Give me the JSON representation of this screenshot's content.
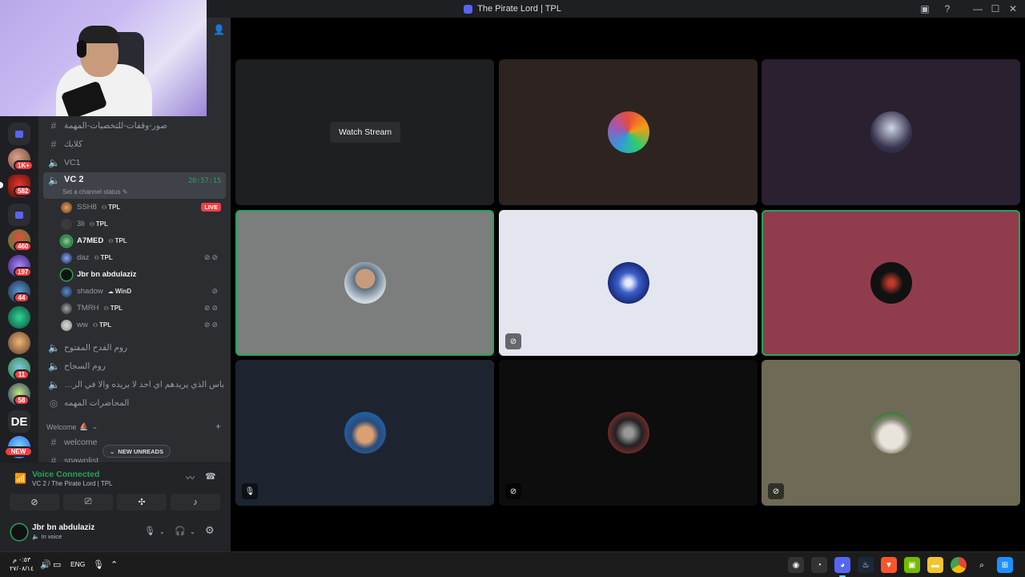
{
  "window": {
    "title": "The Pirate Lord | TPL"
  },
  "rail": {
    "badges": [
      "1K+",
      "582",
      "460",
      "197",
      "44",
      "11",
      "58",
      "NEW"
    ],
    "de_label": "DE"
  },
  "channels": [
    {
      "type": "text",
      "label": "صور-وقفات-للتخصيات-المهمة"
    },
    {
      "type": "text",
      "label": "كلايك"
    },
    {
      "type": "voice",
      "label": "VC1"
    },
    {
      "type": "voice",
      "label": "VC 2",
      "active": true,
      "timer": "20:57:15",
      "status": "Set a channel status"
    }
  ],
  "voice_members": [
    {
      "name": "SSH8",
      "tag": "TPL",
      "live": "LIVE"
    },
    {
      "name": "3li",
      "tag": "TPL"
    },
    {
      "name": "A7MED",
      "tag": "TPL",
      "speaking": true
    },
    {
      "name": "daz",
      "tag": "TPL",
      "state_icons": "🎙̸🎧̸"
    },
    {
      "name": "Jbr bn abdulaziz",
      "tag": "",
      "speaking": true
    },
    {
      "name": "shadow",
      "tag": "WinD",
      "state_icons": "🎙̸"
    },
    {
      "name": "TMRH",
      "tag": "TPL",
      "state_icons": "🎙̸🎧̸"
    },
    {
      "name": "ww",
      "tag": "TPL",
      "state_icons": "🎙̸🎧̸"
    }
  ],
  "channels_after": [
    {
      "type": "voice",
      "label": "روم الفدح المفتوح"
    },
    {
      "type": "voice",
      "label": "روم السجاح"
    },
    {
      "type": "voice",
      "label": "باس الذي يريدهم اي احد لا يريده والا في الروم دايم اوت"
    },
    {
      "type": "stage",
      "label": "المحاضرات المهمه"
    }
  ],
  "category": {
    "label": "Welcome",
    "emoji": "⛵"
  },
  "channels_bottom": [
    {
      "type": "text",
      "label": "welcome"
    },
    {
      "type": "text",
      "label": "spawnlist"
    }
  ],
  "new_unreads": "NEW UNREADS",
  "voice_panel": {
    "title": "Voice Connected",
    "subtitle": "VC 2 / The Pirate Lord | TPL"
  },
  "user_panel": {
    "name": "Jbr bn abdulaziz",
    "status": "In voice"
  },
  "stage": {
    "watch_stream_label": "Watch Stream",
    "tiles": [
      {
        "bg": "#1e1f22",
        "kind": "stream"
      },
      {
        "bg": "#2d2421",
        "avatar": "rainbow",
        "speaking": false
      },
      {
        "bg": "#2a2030",
        "avatar": "night",
        "speaking": false
      },
      {
        "bg": "#7b7e7d",
        "avatar": "person",
        "speaking": true
      },
      {
        "bg": "#e3e5ef",
        "avatar": "blue-swirl",
        "corner": "deafened",
        "speaking": false
      },
      {
        "bg": "#913c4d",
        "avatar": "dark-red",
        "speaking": true
      },
      {
        "bg": "#1d2430",
        "avatar": "pirate",
        "corner": "muted",
        "speaking": false
      },
      {
        "bg": "#0d0d0d",
        "avatar": "robot",
        "corner": "deafened",
        "speaking": false
      },
      {
        "bg": "#6e6a56",
        "avatar": "cat",
        "corner": "deafened",
        "speaking": false
      }
    ]
  },
  "taskbar": {
    "time": "٠:٥٣ م",
    "date": "٢٧/٠٨/١٤",
    "lang": "ENG"
  },
  "colors": {
    "accent": "#5865f2",
    "online": "#23a55a",
    "danger": "#f23f43"
  }
}
